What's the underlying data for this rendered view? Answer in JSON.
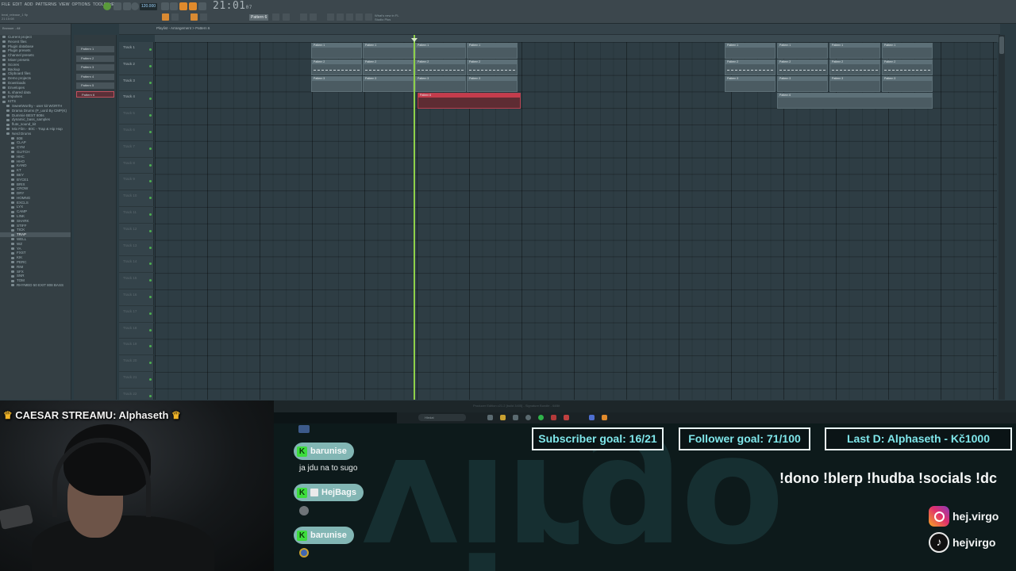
{
  "fl": {
    "menu": [
      "FILE",
      "EDIT",
      "ADD",
      "PATTERNS",
      "VIEW",
      "OPTIONS",
      "TOOLS",
      "HELP"
    ],
    "project": [
      "beat_release_1 flp",
      "21:15:08"
    ],
    "tempo": "120.000",
    "clock": "21:01",
    "clock_sub": "07",
    "pattern_selector": "Pattern 6",
    "news": [
      "What's new in FL",
      "Studio Plus"
    ],
    "playlist_title": "Playlist - Arrangement > Pattern 6",
    "status_text": "Producer Edition v21.2 [build 3405] - Signature Bundle - 64Bit",
    "taskbar_search": "Hledat"
  },
  "browser": {
    "head": "Browser - All",
    "items": [
      {
        "label": "Current project"
      },
      {
        "label": "Recent files"
      },
      {
        "label": "Plugin database"
      },
      {
        "label": "Plugin presets"
      },
      {
        "label": "Channel presets"
      },
      {
        "label": "Mixer presets"
      },
      {
        "label": "Scores"
      },
      {
        "label": "Backup"
      },
      {
        "label": "Clipboard files"
      },
      {
        "label": "Demo projects"
      },
      {
        "label": "Downloads"
      },
      {
        "label": "Envelopes"
      },
      {
        "label": "IL shared data"
      },
      {
        "label": "Impulses"
      },
      {
        "label": "KITS"
      },
      {
        "label": "SweetWorthy - user kit WORTH"
      },
      {
        "label": "Drama Drums (P_uord By CMP(K)"
      },
      {
        "label": "Dummie BEST 808s"
      },
      {
        "label": "dynamic_bass_samples"
      },
      {
        "label": "flute_sound_kit"
      },
      {
        "label": "Mix Film - 80C - Trap & Hip Hop"
      },
      {
        "label": "Nerd Drums"
      },
      {
        "label": "808"
      },
      {
        "label": "CLAP"
      },
      {
        "label": "CYM"
      },
      {
        "label": "GLITCH"
      },
      {
        "label": "HHC"
      },
      {
        "label": "HHO"
      },
      {
        "label": "KAND"
      },
      {
        "label": "KT"
      },
      {
        "label": "BEY"
      },
      {
        "label": "BYCE1"
      },
      {
        "label": "BRIX"
      },
      {
        "label": "CROW"
      },
      {
        "label": "DRY"
      },
      {
        "label": "HOMNG"
      },
      {
        "label": "EXCLS"
      },
      {
        "label": "LYX"
      },
      {
        "label": "CAMP"
      },
      {
        "label": "LINK"
      },
      {
        "label": "SHARK"
      },
      {
        "label": "STIFF"
      },
      {
        "label": "TICK"
      },
      {
        "label": "TRAP"
      },
      {
        "label": "WELL"
      },
      {
        "label": "WZ"
      },
      {
        "label": "YA"
      },
      {
        "label": "FXST"
      },
      {
        "label": "KIK"
      },
      {
        "label": "PERC"
      },
      {
        "label": "RIM"
      },
      {
        "label": "SFX"
      },
      {
        "label": "SNR"
      },
      {
        "label": "TOM"
      },
      {
        "label": "RHYMED 50 EXIT 808 BASS"
      }
    ]
  },
  "patterns": [
    "Pattern 1",
    "Pattern 2",
    "Pattern 3",
    "Pattern 4",
    "Pattern 5",
    "Pattern 6"
  ],
  "tracks": [
    "Track 1",
    "Track 2",
    "Track 3",
    "Track 4",
    "Track 5",
    "Track 6",
    "Track 7",
    "Track 8",
    "Track 9",
    "Track 10",
    "Track 11",
    "Track 12",
    "Track 13",
    "Track 14",
    "Track 15",
    "Track 16",
    "Track 17",
    "Track 18",
    "Track 19",
    "Track 20",
    "Track 21",
    "Track 22"
  ],
  "clip_labels": {
    "p1": "Pattern 1",
    "p2": "Pattern 2",
    "p3": "Pattern 3",
    "p6": "Pattern 6"
  },
  "stream": {
    "caesar_prefix": "CAESAR STREAMU:",
    "caesar_name": "Alphaseth",
    "chat": [
      {
        "user": "barunise",
        "message": "ja jdu na to sugo"
      },
      {
        "user": "HejBags",
        "message": ""
      },
      {
        "user": "barunise",
        "message": ""
      }
    ],
    "goals": {
      "subscriber": "Subscriber goal: 16/21",
      "follower": "Follower goal: 71/100",
      "last_donation": "Last D: Alphaseth - Kč1000"
    },
    "commands": "!dono !blerp !hudba !socials !dc",
    "socials": {
      "instagram": "hej.virgo",
      "tiktok": "hejvirgo"
    },
    "colors": {
      "goal_text": "#7fe6ea",
      "chat_name_bg": "#82b6b4",
      "playhead": "#8ed04a",
      "active_clip": "#c43c4c"
    }
  }
}
